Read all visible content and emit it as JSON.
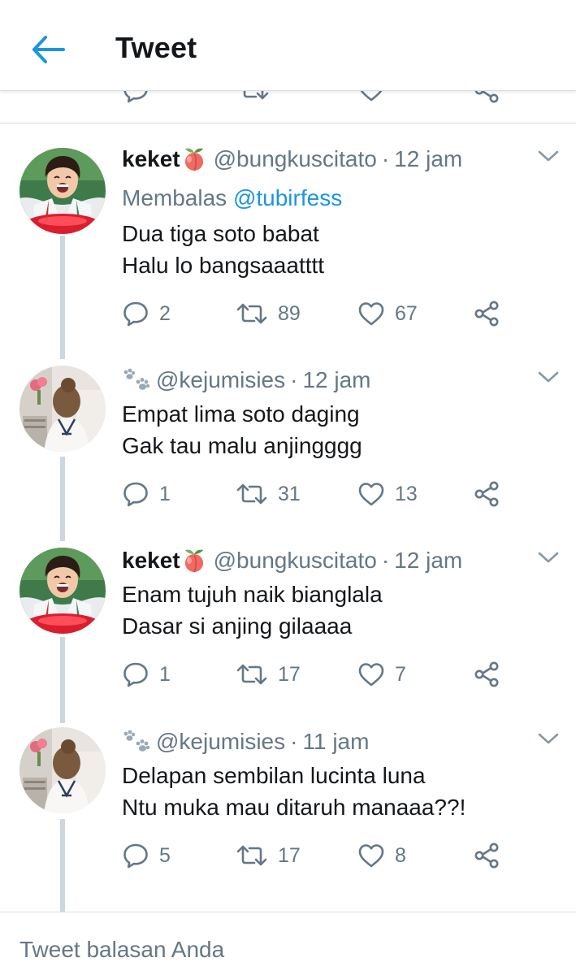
{
  "header": {
    "title": "Tweet"
  },
  "colors": {
    "accent": "#1b95e0",
    "text": "#14171a",
    "muted": "#657786",
    "thread_line": "#cdd7e0",
    "divider": "#d8dde1"
  },
  "icons": {
    "back": "arrow-left-icon",
    "reply": "reply-bubble-icon",
    "retweet": "retweet-icon",
    "like": "heart-icon",
    "share": "share-icon",
    "more": "chevron-down-icon",
    "name_emoji": "peach-emoji",
    "handle_prefix": "paw-prints-emoji"
  },
  "tweets": [
    {
      "name": "keket",
      "handle": "@bungkuscitato",
      "time": "12 jam",
      "reply_prefix": "Membalas",
      "reply_to": "@tubirfess",
      "line1": "Dua tiga soto babat",
      "line2": "Halu lo bangsaaatttt",
      "replies": "2",
      "retweets": "89",
      "likes": "67"
    },
    {
      "name": "",
      "handle": "@kejumisies",
      "time": "12 jam",
      "line1": "Empat lima soto daging",
      "line2": "Gak tau malu anjingggg",
      "replies": "1",
      "retweets": "31",
      "likes": "13"
    },
    {
      "name": "keket",
      "handle": "@bungkuscitato",
      "time": "12 jam",
      "line1": "Enam tujuh naik bianglala",
      "line2": "Dasar si anjing gilaaaa",
      "replies": "1",
      "retweets": "17",
      "likes": "7"
    },
    {
      "name": "",
      "handle": "@kejumisies",
      "time": "11 jam",
      "line1": "Delapan sembilan lucinta luna",
      "line2": "Ntu muka mau ditaruh manaaa??!",
      "replies": "5",
      "retweets": "17",
      "likes": "8"
    }
  ],
  "compose": {
    "placeholder": "Tweet balasan Anda"
  }
}
